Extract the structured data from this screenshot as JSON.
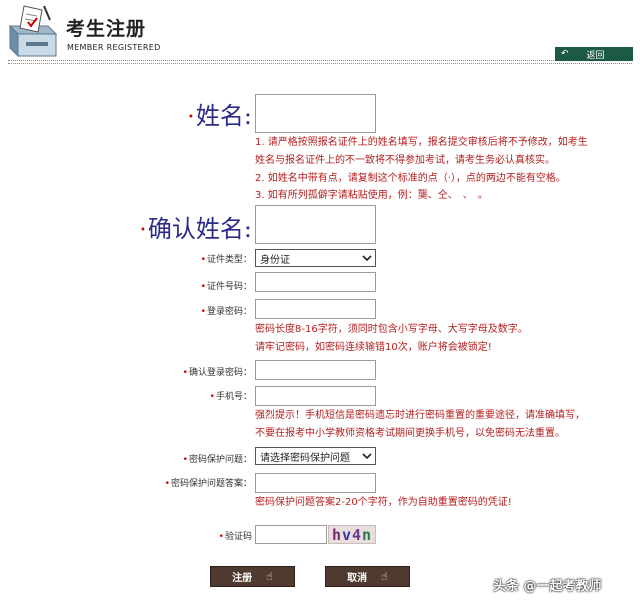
{
  "header": {
    "title": "考生注册",
    "subtitle": "MEMBER REGISTERED",
    "back_label": "返回"
  },
  "form": {
    "name": {
      "label": "姓名:",
      "value": ""
    },
    "name_notes": [
      "1. 请严格按照报名证件上的姓名填写，报名提交审核后将不予修改，如考生",
      "姓名与报名证件上的不一致将不得参加考试，请考生务必认真核实。",
      "2. 如姓名中带有点，请复制这个标准的点（·），点的两边不能有空格。",
      "3. 如有所列孤僻字请粘贴使用，例：龑、仝、　、　。"
    ],
    "confirm_name": {
      "label": "确认姓名:",
      "value": ""
    },
    "id_type": {
      "label": "证件类型：",
      "value": "身份证"
    },
    "id_number": {
      "label": "证件号码：",
      "value": ""
    },
    "password": {
      "label": "登录密码：",
      "value": ""
    },
    "password_notes": [
      "密码长度8-16字符，须同时包含小写字母、大写字母及数字。",
      "请牢记密码，如密码连续输错10次，账户将会被锁定!"
    ],
    "confirm_password": {
      "label": "确认登录密码：",
      "value": ""
    },
    "phone": {
      "label": "手机号：",
      "value": ""
    },
    "phone_notes": [
      "强烈提示！手机短信是密码遗忘时进行密码重置的重要途径，请准确填写，",
      "不要在报考中小学教师资格考试期间更换手机号，以免密码无法重置。"
    ],
    "security_question": {
      "label": "密码保护问题：",
      "value": "请选择密码保护问题"
    },
    "security_answer": {
      "label": "密码保护问题答案：",
      "value": ""
    },
    "answer_note": "密码保护问题答案2-20个字符，作为自助重置密码的凭证!",
    "captcha": {
      "label": "验证码",
      "value": "",
      "code": [
        "h",
        "v",
        "4",
        "n"
      ]
    }
  },
  "buttons": {
    "submit_label": "注册",
    "cancel_label": "取消"
  },
  "watermark": "头条 @一起考教师"
}
